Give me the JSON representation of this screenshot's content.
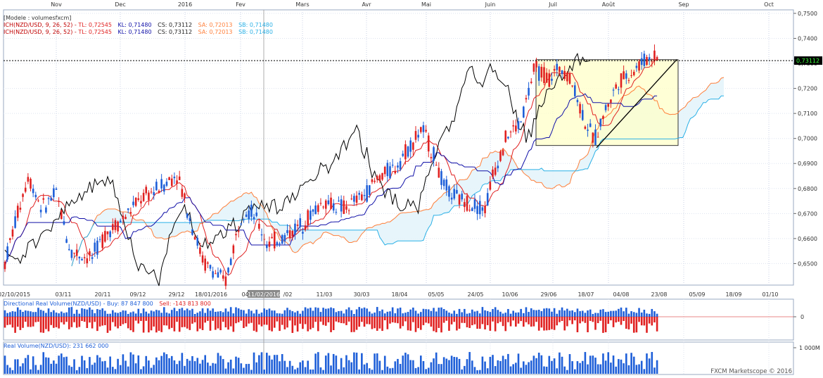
{
  "chart_data": {
    "type": "candlestick",
    "symbol": "NZD/USD",
    "price_axis": {
      "ticks": [
        "0,7500",
        "0,7400",
        "0,7300",
        "0,7200",
        "0,7100",
        "0,7000",
        "0,6900",
        "0,6800",
        "0,6700",
        "0,6600",
        "0,6500"
      ],
      "ylim": [
        0.6414,
        0.7514
      ],
      "last_price_label": "0,73112",
      "last_price": 0.73112
    },
    "month_axis": [
      "Nov",
      "Dec",
      "2016",
      "Fev",
      "Mars",
      "Avr",
      "Mai",
      "Juin",
      "Juil",
      "Août",
      "Sep",
      "Oct"
    ],
    "date_axis": [
      "02/10/2015",
      "03/11",
      "20/11",
      "09/12",
      "29/12",
      "18/01/2016",
      "04/",
      "11/02/2016",
      "/02",
      "11/03",
      "30/03",
      "18/04",
      "05/05",
      "24/05",
      "10/06",
      "29/06",
      "18/07",
      "04/08",
      "23/08",
      "05/09",
      "18/09",
      "01/10"
    ],
    "crosshair_date_label": "11/02/2016",
    "legend": {
      "line1": "[Modele : volumesfxcm]",
      "line2": {
        "name": "ICH(NZD/USD, 9, 26, 52)",
        "tl": "TL: 0,72545",
        "kl": "KL: 0,71480",
        "cs": "CS: 0,73112",
        "sa": "SA: 0,72013",
        "sb": "SB: 0,71480"
      },
      "line3": {
        "name": "ICH(NZD/USD, 9, 26, 52)",
        "tl": "TL: 0,72545",
        "kl": "KL: 0,71480",
        "cs": "CS: 0,73112",
        "sa": "SA: 0,72013",
        "sb": "SB: 0,71480"
      }
    },
    "directional_volume": {
      "title": "Directional Real Volume(NZD/USD)",
      "buy": "Buy: 87 847 800",
      "sell": "Sell: -143 813 800",
      "axis_label": "0"
    },
    "real_volume": {
      "title": "Real Volume(NZD/USD): 231 662 000",
      "axis_label": "1 000M"
    },
    "watermark": "FXCM Marketscope © 2016",
    "colors": {
      "bull": "#1e5fd8",
      "bear": "#e02020",
      "tenkan": "#e02020",
      "kijun": "#1010a8",
      "chikou": "#000000",
      "span_a": "#ff7f3a",
      "span_b": "#2ab0e6",
      "box_fill": "#ffffc8"
    }
  }
}
